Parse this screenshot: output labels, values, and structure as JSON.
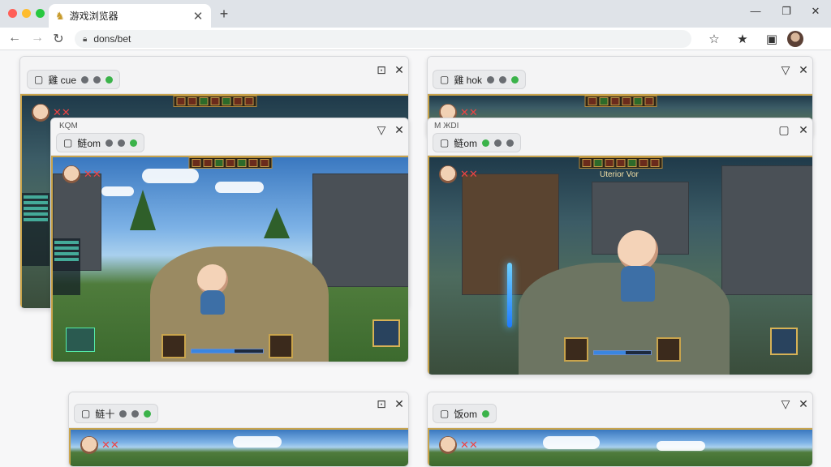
{
  "browser": {
    "tab_title": "游戏浏览器",
    "tab_close": "✕",
    "new_tab": "+",
    "address": "dons/bet",
    "window_controls": [
      "—",
      "❐",
      "✕"
    ],
    "toolbar_icons": [
      "star-icon",
      "extension-icon",
      "sidebar-icon",
      "profile-avatar"
    ]
  },
  "windows": [
    {
      "pill_text": "雞 cue",
      "corner_text": "",
      "ctl1": "⊡",
      "ctl2": "✕"
    },
    {
      "pill_text": "雞 hok",
      "corner_text": "",
      "ctl1": "▽",
      "ctl2": "✕"
    },
    {
      "pill_text": "鲢om",
      "corner_text": "KQM",
      "ctl1": "▽",
      "ctl2": "✕"
    },
    {
      "pill_text": "鲢om",
      "corner_text": "M ЖDI",
      "ctl1": "▢",
      "ctl2": "✕"
    },
    {
      "pill_text": "鲢十",
      "corner_text": "",
      "ctl1": "⊡",
      "ctl2": "✕"
    },
    {
      "pill_text": "饭om",
      "corner_text": "",
      "ctl1": "▽",
      "ctl2": "✕"
    }
  ],
  "game": {
    "hud_mark": "✕✕",
    "banner_text": "Uterior Vor"
  },
  "colors": {
    "accent_green": "#3bb34a",
    "hud_gold": "#c9a44c"
  }
}
